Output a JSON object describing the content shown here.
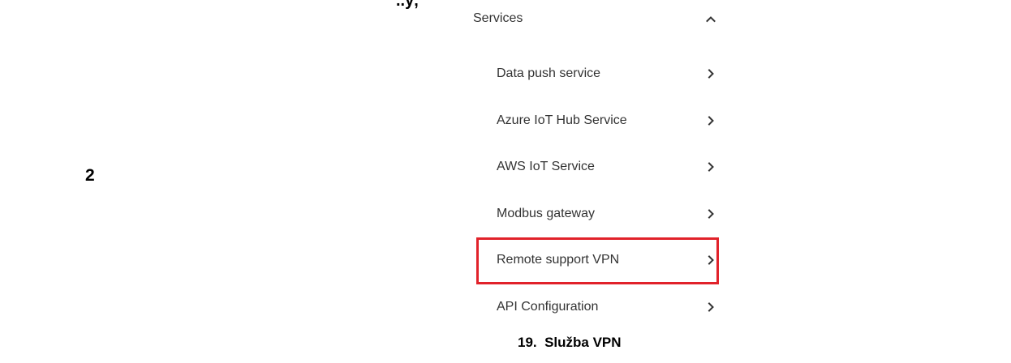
{
  "top_fragment": "..ý,",
  "step_number": "2",
  "services": {
    "label": "Services",
    "expanded_icon": "chevron-up-icon",
    "items": [
      {
        "label": "Data push service",
        "icon": "chevron-right-icon"
      },
      {
        "label": "Azure IoT Hub Service",
        "icon": "chevron-right-icon"
      },
      {
        "label": "AWS IoT Service",
        "icon": "chevron-right-icon"
      },
      {
        "label": "Modbus gateway",
        "icon": "chevron-right-icon"
      },
      {
        "label": "Remote support VPN",
        "icon": "chevron-right-icon",
        "highlighted": true
      },
      {
        "label": "API Configuration",
        "icon": "chevron-right-icon"
      }
    ]
  },
  "highlight_color": "#e1222a",
  "caption": "19.  Služba VPN"
}
